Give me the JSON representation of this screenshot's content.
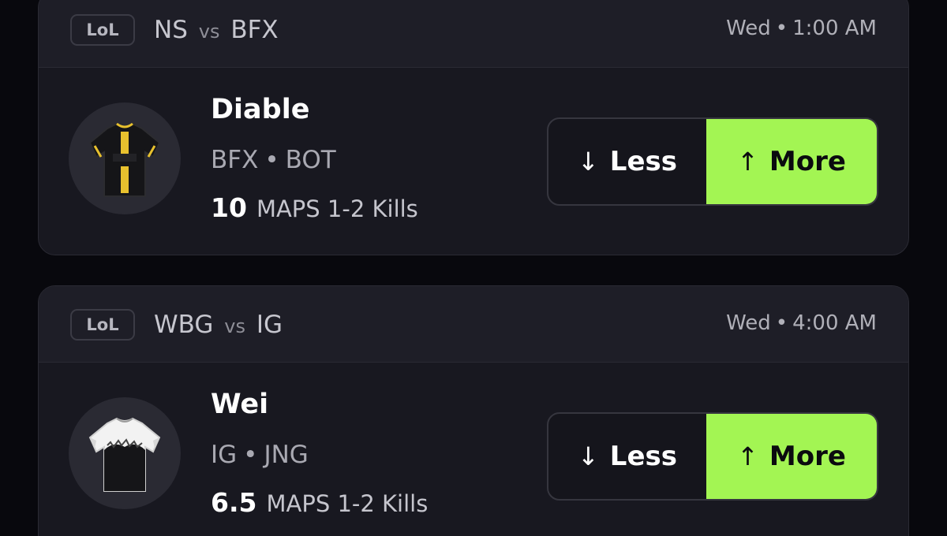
{
  "cards": [
    {
      "game_badge": "LoL",
      "team1": "NS",
      "vs": "vs",
      "team2": "BFX",
      "day": "Wed",
      "time": "1:00 AM",
      "player": "Diable",
      "team": "BFX",
      "position": "BOT",
      "line": "10",
      "stat": "MAPS 1-2 Kills",
      "jersey": "black-gold-jersey-icon",
      "less_label": "Less",
      "more_label": "More"
    },
    {
      "game_badge": "LoL",
      "team1": "WBG",
      "vs": "vs",
      "team2": "IG",
      "day": "Wed",
      "time": "4:00 AM",
      "player": "Wei",
      "team": "IG",
      "position": "JNG",
      "line": "6.5",
      "stat": "MAPS 1-2 Kills",
      "jersey": "white-black-jersey-icon",
      "less_label": "Less",
      "more_label": "More"
    }
  ],
  "sep": "•",
  "arrows": {
    "down": "↓",
    "up": "↑"
  },
  "colors": {
    "accent": "#a3f553",
    "background": "#08080d",
    "card": "#181820"
  }
}
